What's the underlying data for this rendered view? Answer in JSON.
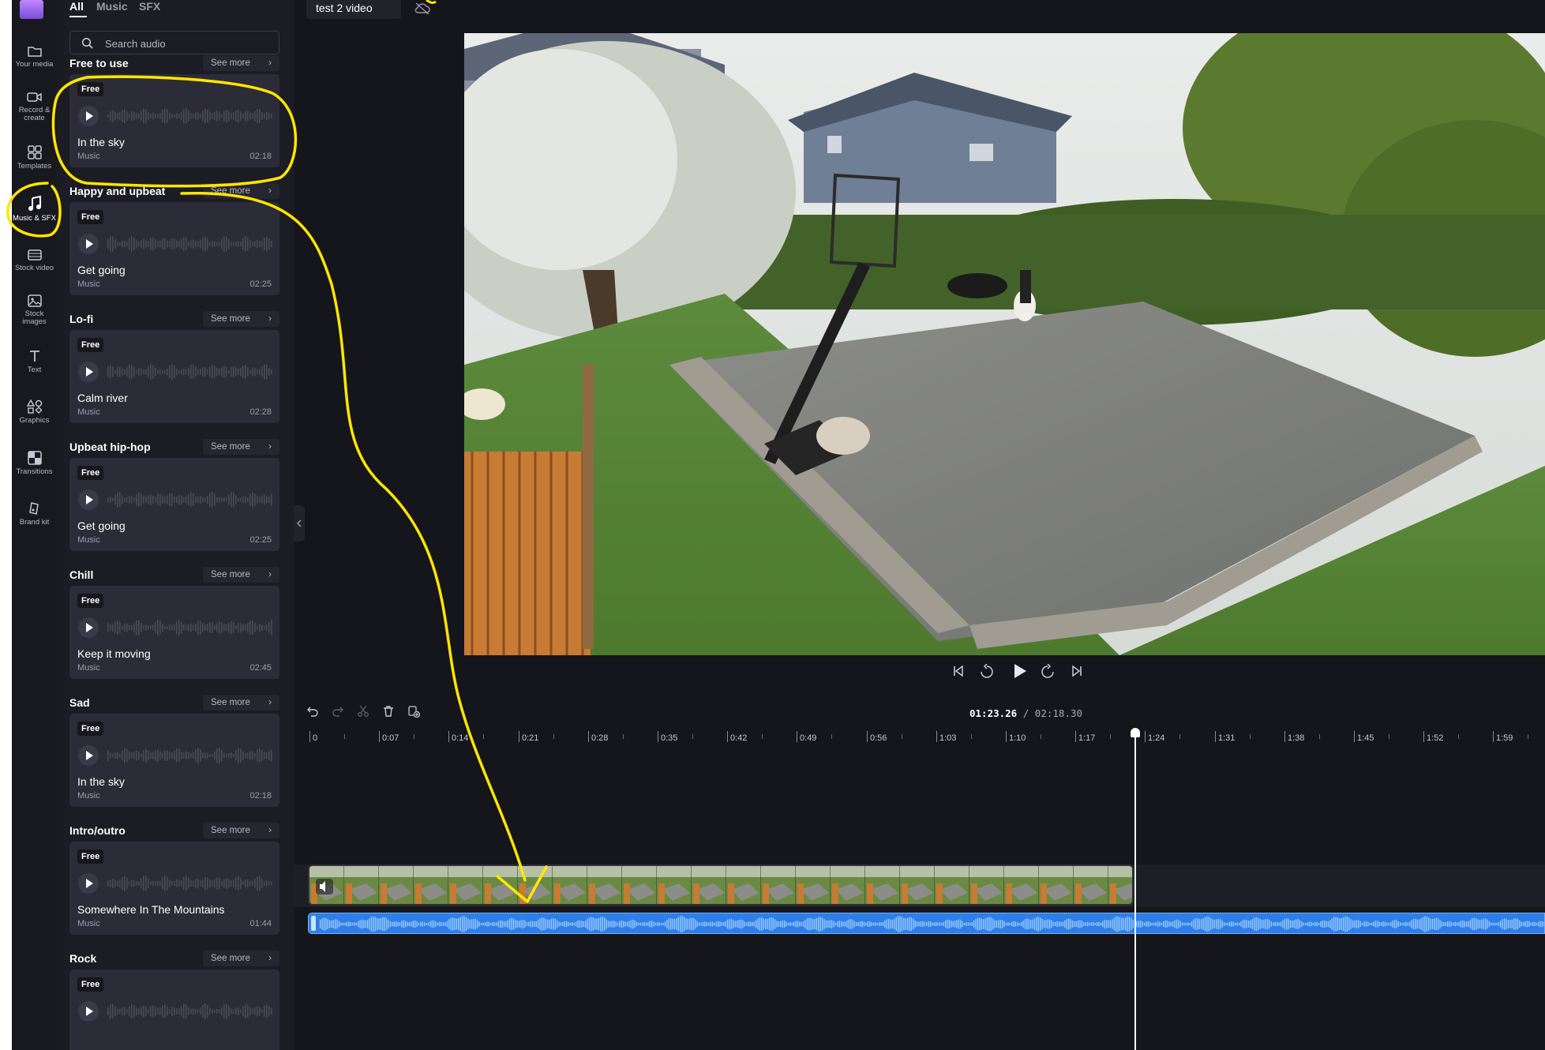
{
  "tabs": [
    {
      "label": "All"
    },
    {
      "label": "Music"
    },
    {
      "label": "SFX"
    }
  ],
  "search": {
    "placeholder": "Search audio"
  },
  "rail": [
    {
      "label": "Your media",
      "icon": "folder-icon"
    },
    {
      "label": "Record & create",
      "icon": "camera-icon"
    },
    {
      "label": "Templates",
      "icon": "templates-icon"
    },
    {
      "label": "Music & SFX",
      "icon": "music-note-icon"
    },
    {
      "label": "Stock video",
      "icon": "film-icon"
    },
    {
      "label": "Stock images",
      "icon": "image-icon"
    },
    {
      "label": "Text",
      "icon": "text-icon"
    },
    {
      "label": "Graphics",
      "icon": "shapes-icon"
    },
    {
      "label": "Transitions",
      "icon": "transitions-icon"
    },
    {
      "label": "Brand kit",
      "icon": "brand-kit-icon"
    }
  ],
  "see_more_label": "See more",
  "sections": [
    {
      "title": "Free to use",
      "card": {
        "badge": "Free",
        "title": "In the sky",
        "type": "Music",
        "duration": "02:18"
      }
    },
    {
      "title": "Happy and upbeat",
      "card": {
        "badge": "Free",
        "title": "Get going",
        "type": "Music",
        "duration": "02:25"
      }
    },
    {
      "title": "Lo-fi",
      "card": {
        "badge": "Free",
        "title": "Calm river",
        "type": "Music",
        "duration": "02:28"
      }
    },
    {
      "title": "Upbeat hip-hop",
      "card": {
        "badge": "Free",
        "title": "Get going",
        "type": "Music",
        "duration": "02:25"
      }
    },
    {
      "title": "Chill",
      "card": {
        "badge": "Free",
        "title": "Keep it moving",
        "type": "Music",
        "duration": "02:45"
      }
    },
    {
      "title": "Sad",
      "card": {
        "badge": "Free",
        "title": "In the sky",
        "type": "Music",
        "duration": "02:18"
      }
    },
    {
      "title": "Intro/outro",
      "card": {
        "badge": "Free",
        "title": "Somewhere In The Mountains",
        "type": "Music",
        "duration": "01:44"
      }
    },
    {
      "title": "Rock",
      "card": {
        "badge": "Free",
        "title": "",
        "type": "",
        "duration": ""
      }
    }
  ],
  "project": {
    "title": "test 2 video"
  },
  "player": {
    "current_time": "01:23.26",
    "separator": " / ",
    "total_time": "02:18.30"
  },
  "timeline": {
    "ticks": [
      "0",
      "0:07",
      "0:14",
      "0:21",
      "0:28",
      "0:35",
      "0:42",
      "0:49",
      "0:56",
      "1:03",
      "1:10",
      "1:17",
      "1:24",
      "1:31",
      "1:38",
      "1:45",
      "1:52",
      "1:59"
    ],
    "playhead": "01:23.26"
  },
  "colors": {
    "accent_audio": "#2f7ee8",
    "annotation": "#ffe600",
    "panel": "#1c1c24",
    "card": "#2c2c38"
  }
}
